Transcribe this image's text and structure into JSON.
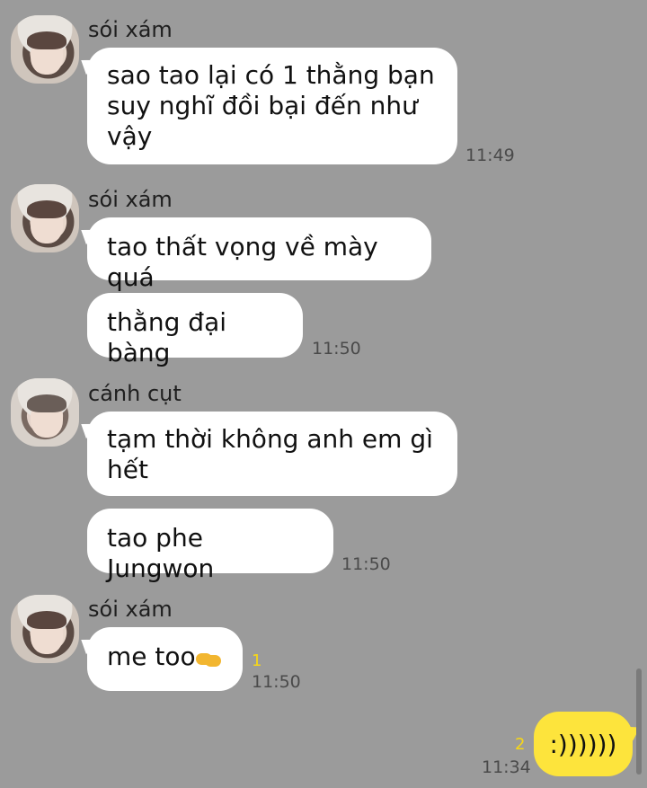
{
  "messages": [
    {
      "sender": "sói xám",
      "bubbles": [
        "sao tao lại có 1 thằng bạn suy nghĩ đồi bại đến như vậy"
      ],
      "time": "11:49"
    },
    {
      "sender": "sói xám",
      "bubbles": [
        "tao thất vọng về mày quá",
        "thằng đại bàng"
      ],
      "time": "11:50"
    },
    {
      "sender": "cánh cụt",
      "bubbles": [
        "tạm thời không anh em gì hết",
        "tao phe Jungwon"
      ],
      "time": "11:50"
    },
    {
      "sender": "sói xám",
      "bubbles": [
        "me too"
      ],
      "emoji": "handshake-icon",
      "unread": "1",
      "time": "11:50"
    }
  ],
  "my_message": {
    "text": ":))))))",
    "unread": "2",
    "time": "11:34"
  },
  "colors": {
    "background": "#9b9b9b",
    "incoming_bubble": "#ffffff",
    "outgoing_bubble": "#fde43c",
    "unread_count": "#f7d716"
  }
}
